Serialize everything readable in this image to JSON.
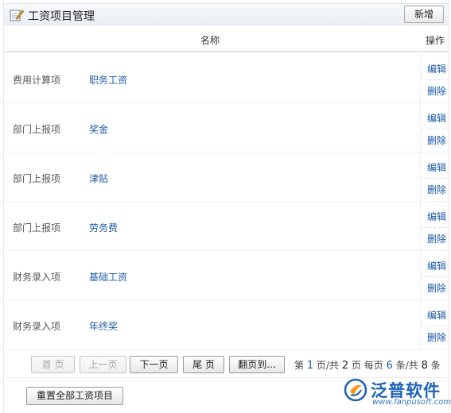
{
  "header": {
    "title": "工资项目管理",
    "new_button": "新增"
  },
  "table": {
    "columns": {
      "name": "名称",
      "operation": "操作"
    },
    "rows": [
      {
        "category": "费用计算项",
        "name": "职务工资",
        "edit": "编辑",
        "delete": "删除"
      },
      {
        "category": "部门上报项",
        "name": "奖金",
        "edit": "编辑",
        "delete": "删除"
      },
      {
        "category": "部门上报项",
        "name": "津贴",
        "edit": "编辑",
        "delete": "删除"
      },
      {
        "category": "部门上报项",
        "name": "劳务费",
        "edit": "编辑",
        "delete": "删除"
      },
      {
        "category": "财务录入项",
        "name": "基础工资",
        "edit": "编辑",
        "delete": "删除"
      },
      {
        "category": "财务录入项",
        "name": "年终奖",
        "edit": "编辑",
        "delete": "删除"
      }
    ]
  },
  "pager": {
    "first": "首 页",
    "prev": "上一页",
    "next": "下一页",
    "last": "尾 页",
    "jump": "翻页到...",
    "text_page": "第",
    "current_page": "1",
    "text_of": "页/共",
    "total_pages": "2",
    "text_per_page": "页 每页",
    "per_page": "6",
    "text_total": "条/共",
    "total_items": "8",
    "text_items": "条"
  },
  "footer": {
    "reset_button": "重置全部工资项目"
  },
  "brand": {
    "name": "泛普软件",
    "url": "www.fanpusoft.com"
  },
  "colors": {
    "link": "#1c5aa6",
    "brand": "#1e62b5"
  }
}
